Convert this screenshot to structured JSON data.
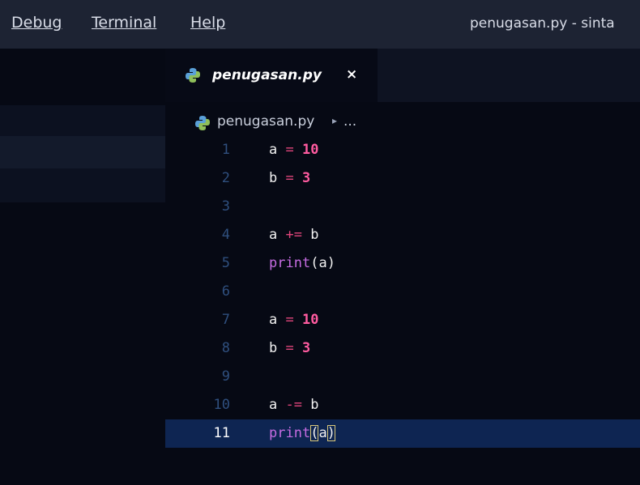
{
  "menu": {
    "items": [
      {
        "label": "Debug"
      },
      {
        "label": "Terminal"
      },
      {
        "label": "Help"
      }
    ],
    "window_title": "penugasan.py - sinta"
  },
  "tab": {
    "label": "penugasan.py",
    "close_glyph": "×",
    "icon": "python-file-icon"
  },
  "breadcrumb": {
    "file": "penugasan.py",
    "separator": "▸",
    "more": "..."
  },
  "editor": {
    "current_line": 11,
    "lines": [
      {
        "number": "1",
        "tokens": [
          {
            "t": "a",
            "k": "var"
          },
          {
            "t": " "
          },
          {
            "t": "=",
            "k": "op"
          },
          {
            "t": " "
          },
          {
            "t": "10",
            "k": "num"
          }
        ]
      },
      {
        "number": "2",
        "tokens": [
          {
            "t": "b",
            "k": "var"
          },
          {
            "t": " "
          },
          {
            "t": "=",
            "k": "op"
          },
          {
            "t": " "
          },
          {
            "t": "3",
            "k": "num"
          }
        ]
      },
      {
        "number": "3",
        "tokens": []
      },
      {
        "number": "4",
        "tokens": [
          {
            "t": "a",
            "k": "var"
          },
          {
            "t": " "
          },
          {
            "t": "+=",
            "k": "op"
          },
          {
            "t": " "
          },
          {
            "t": "b",
            "k": "var"
          }
        ]
      },
      {
        "number": "5",
        "tokens": [
          {
            "t": "print",
            "k": "fn"
          },
          {
            "t": "(",
            "k": "paren"
          },
          {
            "t": "a",
            "k": "var"
          },
          {
            "t": ")",
            "k": "paren"
          }
        ]
      },
      {
        "number": "6",
        "tokens": []
      },
      {
        "number": "7",
        "tokens": [
          {
            "t": "a",
            "k": "var"
          },
          {
            "t": " "
          },
          {
            "t": "=",
            "k": "op"
          },
          {
            "t": " "
          },
          {
            "t": "10",
            "k": "num"
          }
        ]
      },
      {
        "number": "8",
        "tokens": [
          {
            "t": "b",
            "k": "var"
          },
          {
            "t": " "
          },
          {
            "t": "=",
            "k": "op"
          },
          {
            "t": " "
          },
          {
            "t": "3",
            "k": "num"
          }
        ]
      },
      {
        "number": "9",
        "tokens": []
      },
      {
        "number": "10",
        "tokens": [
          {
            "t": "a",
            "k": "var"
          },
          {
            "t": " "
          },
          {
            "t": "-=",
            "k": "op"
          },
          {
            "t": " "
          },
          {
            "t": "b",
            "k": "var"
          }
        ]
      },
      {
        "number": "11",
        "tokens": [
          {
            "t": "print",
            "k": "fn"
          },
          {
            "t": "(",
            "k": "paren",
            "match": true
          },
          {
            "t": "a",
            "k": "var"
          },
          {
            "t": ")",
            "k": "paren",
            "match": true
          }
        ]
      }
    ]
  },
  "colors": {
    "menubar_bg": "#1d2333",
    "editor_bg": "#060914",
    "current_line_bg": "#0e2552",
    "keyword_number": "#ff5ba0",
    "builtin_function": "#c66ce2",
    "operator": "#e0457b"
  }
}
